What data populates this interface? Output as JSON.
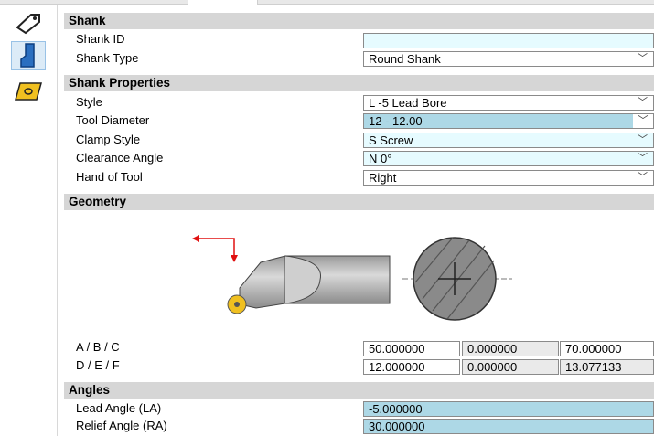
{
  "toolbar": {
    "items": [
      {
        "icon": "tool-tag-icon"
      },
      {
        "icon": "shank-icon",
        "active": true
      },
      {
        "icon": "insert-icon"
      }
    ]
  },
  "sections": {
    "shank": {
      "title": "Shank",
      "shank_id": {
        "label": "Shank ID",
        "value": ""
      },
      "shank_type": {
        "label": "Shank Type",
        "value": "Round Shank"
      }
    },
    "shank_properties": {
      "title": "Shank Properties",
      "style": {
        "label": "Style",
        "value": "L -5 Lead Bore"
      },
      "tool_diameter": {
        "label": "Tool Diameter",
        "value": "12 - 12.00"
      },
      "clamp_style": {
        "label": "Clamp Style",
        "value": "S Screw"
      },
      "clearance_angle": {
        "label": "Clearance Angle",
        "value": "N  0°"
      },
      "hand_of_tool": {
        "label": "Hand of Tool",
        "value": "Right"
      }
    },
    "geometry": {
      "title": "Geometry",
      "abc": {
        "label": "A / B / C",
        "values": [
          "50.000000",
          "0.000000",
          "70.000000"
        ]
      },
      "def": {
        "label": "D / E / F",
        "values": [
          "12.000000",
          "0.000000",
          "13.077133"
        ]
      }
    },
    "angles": {
      "title": "Angles",
      "lead_angle": {
        "label": "Lead Angle (LA)",
        "value": "-5.000000"
      },
      "relief_angle": {
        "label": "Relief Angle (RA)",
        "value": "30.000000"
      }
    }
  },
  "colors": {
    "header_bg": "#d6d6d6",
    "highlight": "#add8e6",
    "light_field": "#e6fbff",
    "arrow": "#e01010",
    "insert": "#f0c020"
  }
}
